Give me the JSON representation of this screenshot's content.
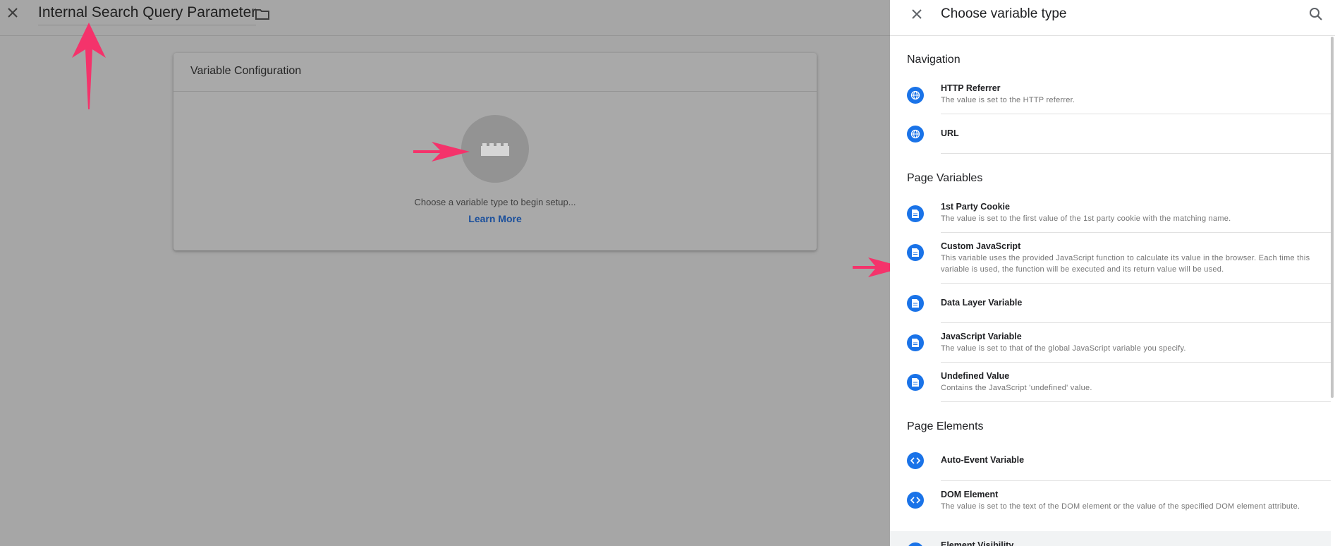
{
  "editor": {
    "title": "Internal Search Query Parameter",
    "card": {
      "title": "Variable Configuration",
      "setup_text": "Choose a variable type to begin setup...",
      "learn_more": "Learn More"
    }
  },
  "panel": {
    "title": "Choose variable type",
    "sections": [
      {
        "title": "Navigation",
        "items": [
          {
            "icon": "globe-icon",
            "name": "HTTP Referrer",
            "description": "The value is set to the HTTP referrer."
          },
          {
            "icon": "globe-icon",
            "name": "URL",
            "description": ""
          }
        ]
      },
      {
        "title": "Page Variables",
        "items": [
          {
            "icon": "document-icon",
            "name": "1st Party Cookie",
            "description": "The value is set to the first value of the 1st party cookie with the matching name."
          },
          {
            "icon": "document-icon",
            "name": "Custom JavaScript",
            "description": "This variable uses the provided JavaScript function to calculate its value in the browser. Each time this variable is used, the function will be executed and its return value will be used."
          },
          {
            "icon": "document-icon",
            "name": "Data Layer Variable",
            "description": ""
          },
          {
            "icon": "document-icon",
            "name": "JavaScript Variable",
            "description": "The value is set to that of the global JavaScript variable you specify."
          },
          {
            "icon": "document-icon",
            "name": "Undefined Value",
            "description": "Contains the JavaScript 'undefined' value."
          }
        ]
      },
      {
        "title": "Page Elements",
        "items": [
          {
            "icon": "code-icon",
            "name": "Auto-Event Variable",
            "description": ""
          },
          {
            "icon": "code-icon",
            "name": "DOM Element",
            "description": "The value is set to the text of the DOM element or the value of the specified DOM element attribute."
          },
          {
            "icon": "code-icon",
            "name": "Element Visibility",
            "description": ""
          }
        ]
      }
    ]
  },
  "colors": {
    "accent": "#1a73e8",
    "annotation_arrow": "#f4336b",
    "overlay": "#a6a6a6"
  }
}
